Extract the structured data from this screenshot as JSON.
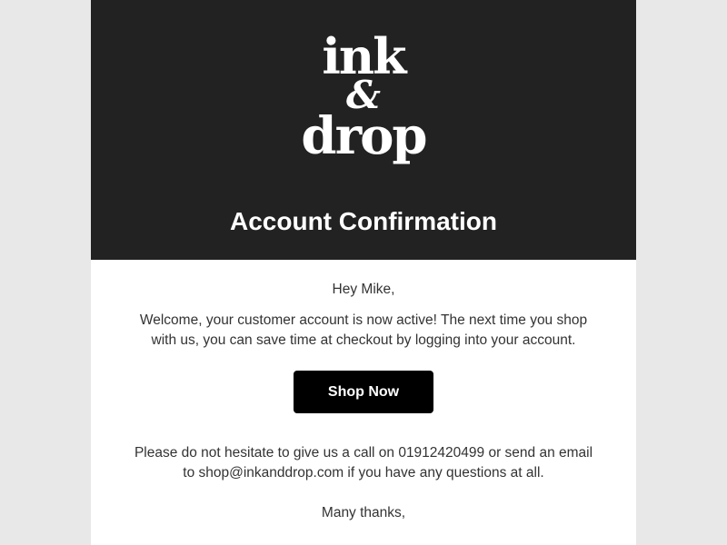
{
  "header": {
    "logo_line1": "ink",
    "logo_line2": "&",
    "logo_line3": "drop",
    "title": "Account Confirmation"
  },
  "body": {
    "greeting": "Hey Mike,",
    "welcome_text": "Welcome, your customer account is now active! The next time you shop with us, you can save time at checkout by logging into your account.",
    "cta_label": "Shop Now",
    "contact_text": "Please do not hesitate to give us a call on 01912420499 or send an email to shop@inkanddrop.com if you have any questions at all.",
    "signoff": "Many thanks,"
  },
  "colors": {
    "header_bg": "#222222",
    "page_bg": "#e8e8e8",
    "button_bg": "#000000",
    "text": "#333333"
  }
}
